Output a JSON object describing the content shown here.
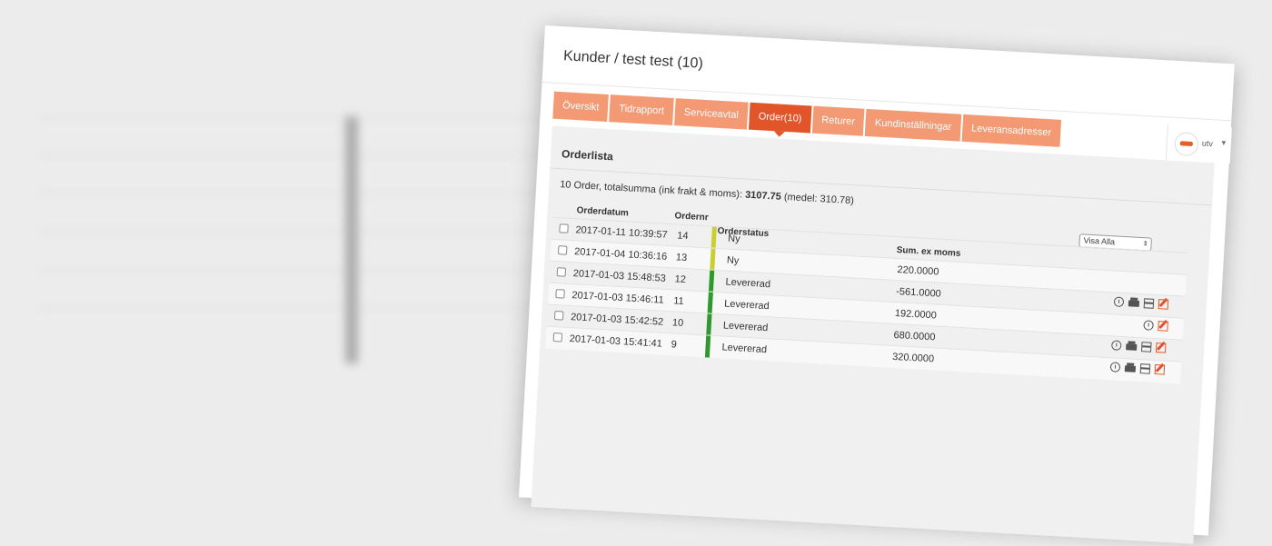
{
  "window_title": "Kunder / test test (10)",
  "user": {
    "name": "utv"
  },
  "tabs": [
    {
      "label": "Översikt",
      "active": false
    },
    {
      "label": "Tidrapport",
      "active": false
    },
    {
      "label": "Serviceavtal",
      "active": false
    },
    {
      "label": "Order(10)",
      "active": true
    },
    {
      "label": "Returer",
      "active": false
    },
    {
      "label": "Kundinställningar",
      "active": false
    },
    {
      "label": "Leveransadresser",
      "active": false
    }
  ],
  "panel": {
    "title": "Orderlista",
    "summary_prefix": "10 Order, totalsumma (ink frakt & moms):",
    "summary_total": "3107.75",
    "summary_suffix": "(medel: 310.78)",
    "filter_value": "Visa Alla"
  },
  "table": {
    "headers": {
      "date": "Orderdatum",
      "nr": "Ordernr",
      "status": "Orderstatus",
      "sum": "Sum. ex moms"
    },
    "rows": [
      {
        "date": "2017-01-11 10:39:57",
        "nr": "14",
        "status": "Ny",
        "sum": "",
        "status_color": "#c9cf30",
        "actions": []
      },
      {
        "date": "2017-01-04 10:36:16",
        "nr": "13",
        "status": "Ny",
        "sum": "220.0000",
        "status_color": "#c9cf30",
        "actions": []
      },
      {
        "date": "2017-01-03 15:48:53",
        "nr": "12",
        "status": "Levererad",
        "sum": "-561.0000",
        "status_color": "#2e9a2e",
        "actions": [
          "history-icon",
          "print-icon",
          "package-icon",
          "edit-icon"
        ]
      },
      {
        "date": "2017-01-03 15:46:11",
        "nr": "11",
        "status": "Levererad",
        "sum": "192.0000",
        "status_color": "#2e9a2e",
        "actions": [
          "history-icon",
          "edit-icon"
        ]
      },
      {
        "date": "2017-01-03 15:42:52",
        "nr": "10",
        "status": "Levererad",
        "sum": "680.0000",
        "status_color": "#2e9a2e",
        "actions": [
          "history-icon",
          "print-icon",
          "package-icon",
          "edit-icon"
        ]
      },
      {
        "date": "2017-01-03 15:41:41",
        "nr": "9",
        "status": "Levererad",
        "sum": "320.0000",
        "status_color": "#2e9a2e",
        "actions": [
          "history-icon",
          "print-icon",
          "package-icon",
          "edit-icon"
        ]
      }
    ]
  },
  "colors": {
    "tab": "#f39a75",
    "tab_active": "#e2552a",
    "status_new": "#c9cf30",
    "status_delivered": "#2e9a2e"
  }
}
